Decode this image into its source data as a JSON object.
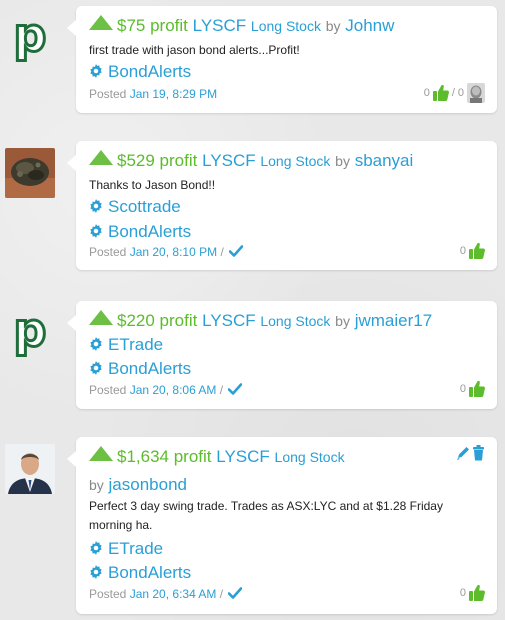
{
  "entries": [
    {
      "avatar_type": "logo",
      "avatar_letter": "p",
      "profit": "$75 profit",
      "ticker": "LYSCF",
      "position_type": "Long Stock",
      "by": "by",
      "user": "Johnw",
      "text": "first trade with jason bond alerts...Profit!",
      "tags": [
        "BondAlerts"
      ],
      "posted_label": "Posted",
      "date": "Jan 19, 8:29 PM",
      "likes": "0",
      "vote_sep": "/",
      "dislikes": "0"
    },
    {
      "avatar_type": "photo-rock",
      "profit": "$529 profit",
      "ticker": "LYSCF",
      "position_type": "Long Stock",
      "by": "by",
      "user": "sbanyai",
      "text": "Thanks to Jason Bond!!",
      "tags": [
        "Scottrade",
        "BondAlerts"
      ],
      "posted_label": "Posted",
      "date": "Jan 20, 8:10 PM",
      "date_sep": "/",
      "likes": "0"
    },
    {
      "avatar_type": "logo",
      "avatar_letter": "p",
      "profit": "$220 profit",
      "ticker": "LYSCF",
      "position_type": "Long Stock",
      "by": "by",
      "user": "jwmaier17",
      "tags": [
        "ETrade",
        "BondAlerts"
      ],
      "posted_label": "Posted",
      "date": "Jan 20, 8:06 AM",
      "date_sep": "/",
      "likes": "0"
    },
    {
      "avatar_type": "photo-man",
      "profit": "$1,634 profit",
      "ticker": "LYSCF",
      "position_type": "Long Stock",
      "by": "by",
      "user": "jasonbond",
      "text_line1": "Perfect 3 day swing trade. Trades as ASX:LYC and at $1.28 Friday",
      "text_line2": "morning ha.",
      "tags": [
        "ETrade",
        "BondAlerts"
      ],
      "posted_label": "Posted",
      "date": "Jan 20, 6:34 AM",
      "date_sep": "/",
      "likes": "0"
    }
  ],
  "colors": {
    "profit_green": "#5cbc2c",
    "link_blue": "#2a9fd6",
    "logo_green": "#1f6e3a"
  }
}
